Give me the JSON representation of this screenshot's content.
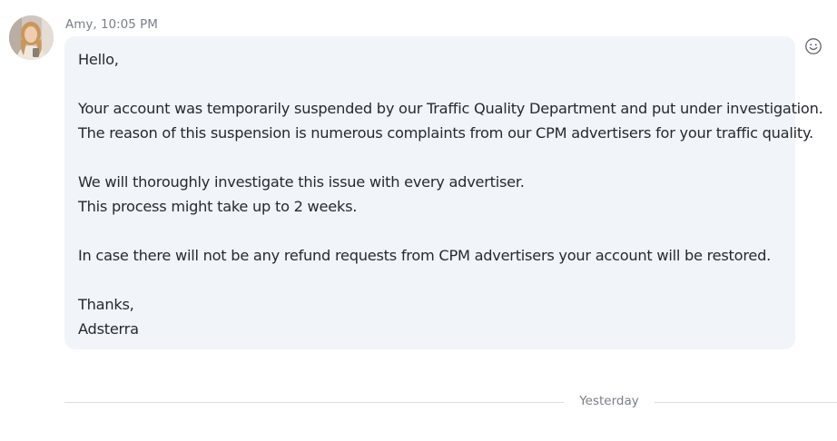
{
  "message": {
    "sender": "Amy, 10:05 PM",
    "lines": [
      "Hello,",
      "",
      "Your account was temporarily suspended by our Traffic Quality Department and put under investigation.",
      "The reason of this suspension is numerous complaints from our CPM advertisers for your traffic quality.",
      "",
      "We will thoroughly investigate this issue with every advertiser.",
      "This process might take up to 2 weeks.",
      "",
      "In case there will not be any refund requests from CPM advertisers your account will be restored.",
      "",
      "Thanks,",
      "Adsterra"
    ]
  },
  "divider": {
    "label": "Yesterday"
  },
  "icons": {
    "reaction": "smiley-face-icon",
    "avatar": "user-avatar"
  },
  "colors": {
    "bubble_background": "#f1f4f8",
    "meta_text": "#7a7f86",
    "body_text": "#262a30"
  }
}
